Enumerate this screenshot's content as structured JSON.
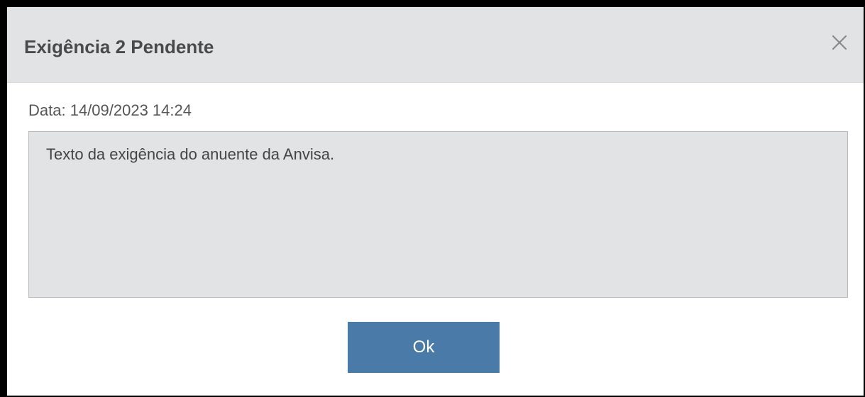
{
  "dialog": {
    "title": "Exigência 2 Pendente",
    "close_icon": "close-icon",
    "date_label": "Data:",
    "date_value": "14/09/2023 14:24",
    "message": "Texto da exigência do anuente da Anvisa.",
    "ok_label": "Ok"
  },
  "colors": {
    "header_bg": "#e2e3e5",
    "message_bg": "#e2e3e5",
    "ok_button_bg": "#4a7aa8",
    "title_text": "#4a4a4a"
  }
}
